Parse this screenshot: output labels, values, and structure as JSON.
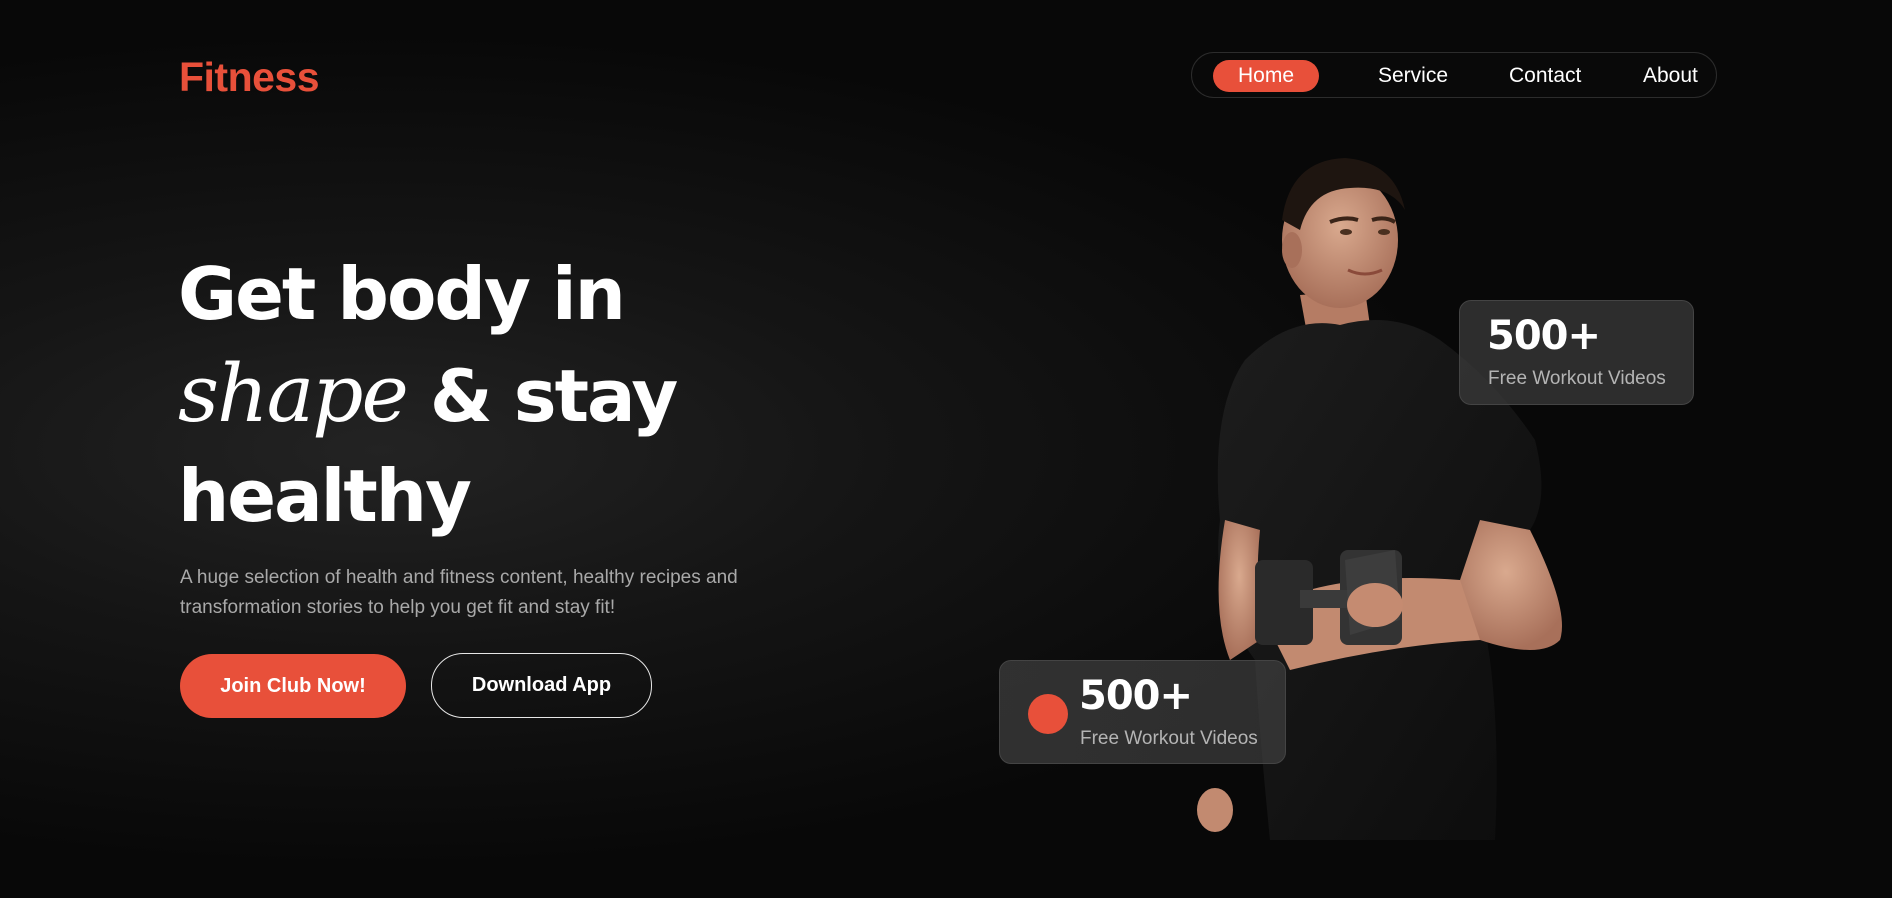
{
  "brand": {
    "logo": "Fitness",
    "accent_color": "#e8503a"
  },
  "nav": {
    "items": [
      {
        "label": "Home",
        "active": true
      },
      {
        "label": "Service",
        "active": false
      },
      {
        "label": "Contact",
        "active": false
      },
      {
        "label": "About",
        "active": false
      }
    ]
  },
  "hero": {
    "headline_part1": "Get body in",
    "headline_script": "shape",
    "headline_part2": "& stay",
    "headline_part3": "healthy",
    "subtext": "A huge selection of health and fitness content, healthy recipes and transformation stories to help you get fit and stay fit!",
    "primary_button": "Join Club Now!",
    "secondary_button": "Download App"
  },
  "stats": [
    {
      "value": "500+",
      "label": "Free Workout Videos"
    },
    {
      "value": "500+",
      "label": "Free Workout Videos"
    }
  ],
  "icons": {
    "stat_bullet": "red-dot-icon"
  }
}
